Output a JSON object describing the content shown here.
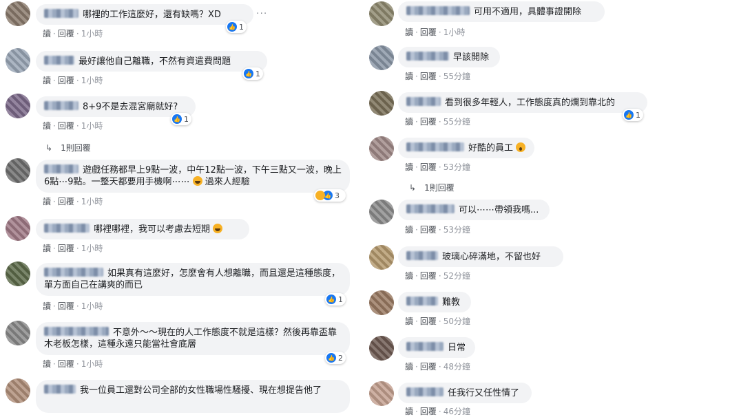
{
  "ui": {
    "reply_action": "讀",
    "reply2_action": "回覆",
    "separator": "·",
    "more_dots": "···"
  },
  "left": [
    {
      "text": "哪裡的工作這麼好，還有缺嗎？XD",
      "time": "1小時",
      "reactions": "1"
    },
    {
      "text": "最好讓他自己離職，不然有資遣費問題",
      "time": "1小時",
      "reactions": "1"
    },
    {
      "text": "8+9不是去混宮廟就好?",
      "time": "1小時",
      "reactions": "1",
      "replies": "1則回覆"
    },
    {
      "text": "遊戲任務都早上9點一波，中午12點一波，下午三點又一波，晚上6點⋯9點。一整天都要用手機啊⋯⋯",
      "text_tail": "過來人經驗",
      "time": "1小時",
      "reactions": "3"
    },
    {
      "text": "哪裡哪裡，我可以考慮去短期",
      "time": "1小時"
    },
    {
      "text": "如果真有這麼好，怎麼會有人想離職，而且還是這種態度，單方面自己在講爽的而已",
      "time": "1小時",
      "reactions": "1"
    },
    {
      "text": "不意外～～現在的人工作態度不就是這樣？然後再靠盃靠木老板怎樣，這種永遠只能當社會底層",
      "time": "1小時",
      "reactions": "2"
    },
    {
      "text": "我一位員工還對公司全部的女性職場性騷擾、現在想提告他了",
      "time": ""
    }
  ],
  "right": [
    {
      "text": "可用不適用，具體事證開除",
      "time": "1小時"
    },
    {
      "text": "早該開除",
      "time": "55分鐘"
    },
    {
      "text": "看到很多年輕人，工作態度真的爛到靠北的",
      "time": "55分鐘",
      "reactions": "1"
    },
    {
      "text": "好酷的員工",
      "time": "53分鐘",
      "replies": "1則回覆"
    },
    {
      "text": "可以⋯⋯帶領我嗎...",
      "time": "53分鐘"
    },
    {
      "text": "玻璃心碎滿地，不留也好",
      "time": "52分鐘"
    },
    {
      "text": "難教",
      "time": "50分鐘"
    },
    {
      "text": "日常",
      "time": "48分鐘"
    },
    {
      "text": "任我行又任性情了",
      "time": "46分鐘"
    }
  ],
  "colors": {
    "bubble": "#f2f3f5",
    "like": "#1877f2",
    "link_text": "#4b4f56",
    "time": "#90949c"
  }
}
